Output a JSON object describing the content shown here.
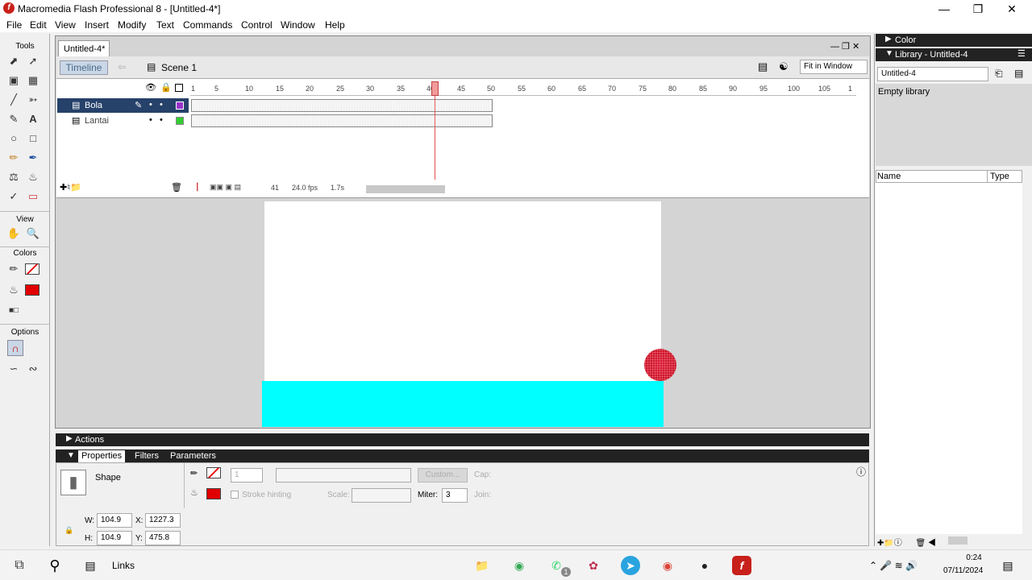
{
  "window": {
    "title": "Macromedia Flash Professional 8 - [Untitled-4*]"
  },
  "menu": [
    "File",
    "Edit",
    "View",
    "Insert",
    "Modify",
    "Text",
    "Commands",
    "Control",
    "Window",
    "Help"
  ],
  "tools": {
    "header": "Tools",
    "view": "View",
    "colors": "Colors",
    "options": "Options"
  },
  "document": {
    "tab": "Untitled-4*",
    "timeline_label": "Timeline",
    "scene": "Scene 1",
    "zoom": "Fit in Window"
  },
  "timeline": {
    "ruler": [
      "1",
      "5",
      "10",
      "15",
      "20",
      "25",
      "30",
      "35",
      "40",
      "45",
      "50",
      "55",
      "60",
      "65",
      "70",
      "75",
      "80",
      "85",
      "90",
      "95",
      "100",
      "105",
      "1"
    ],
    "layers": [
      {
        "name": "Bola",
        "color": "#9933cc"
      },
      {
        "name": "Lantai",
        "color": "#33cc33"
      }
    ],
    "current_frame": "41",
    "fps": "24.0 fps",
    "time": "1.7s"
  },
  "stage": {
    "floor_color": "#00ffff",
    "ball_color": "#d8203a"
  },
  "panels": {
    "actions": "Actions",
    "tabs": [
      "Properties",
      "Filters",
      "Parameters"
    ]
  },
  "properties": {
    "type": "Shape",
    "stroke_height": "1",
    "custom": "Custom...",
    "cap": "Cap:",
    "stroke_hinting": "Stroke hinting",
    "scale": "Scale:",
    "miter_label": "Miter:",
    "miter": "3",
    "join": "Join:",
    "w_label": "W:",
    "w": "104.9",
    "x_label": "X:",
    "x": "1227.3",
    "h_label": "H:",
    "h": "104.9",
    "y_label": "Y:",
    "y": "475.8"
  },
  "right": {
    "color": "Color",
    "library": "Library - Untitled-4",
    "lib_select": "Untitled-4",
    "empty": "Empty library",
    "col_name": "Name",
    "col_type": "Type"
  },
  "taskbar": {
    "links": "Links",
    "time": "0:24",
    "date": "07/11/2024",
    "badge": "1"
  }
}
